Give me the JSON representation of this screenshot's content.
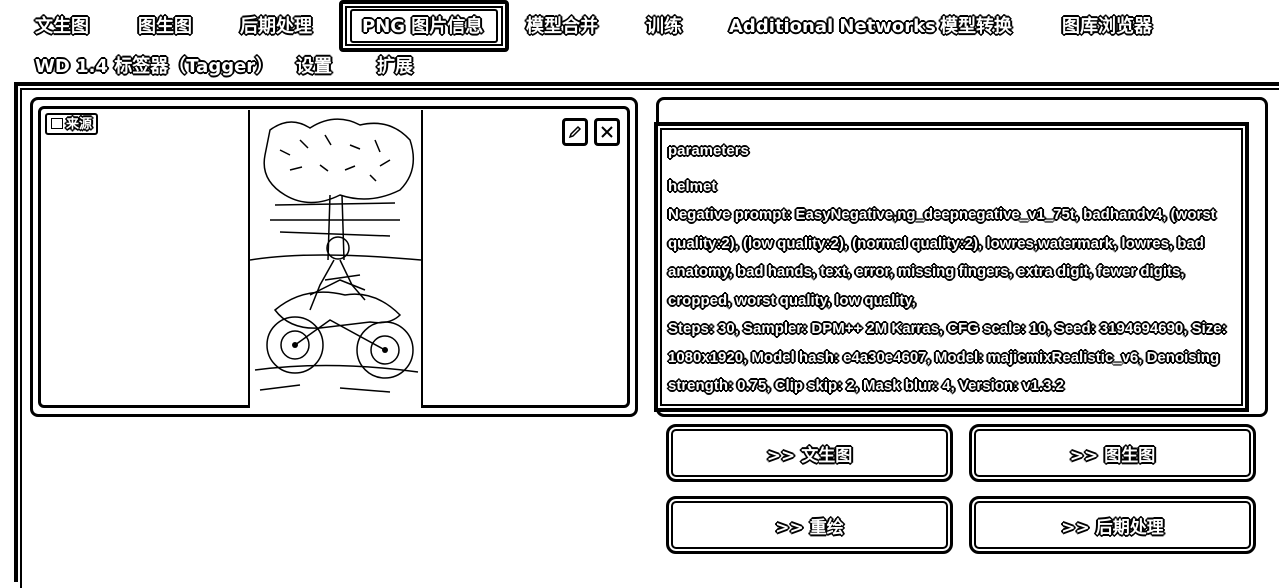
{
  "tabs": {
    "row1": [
      "文生图",
      "图生图",
      "后期处理",
      "PNG 图片信息",
      "模型合并",
      "训练",
      "Additional Networks",
      "模型转换",
      "图库浏览器"
    ],
    "row2": [
      "WD 1.4 标签器（Tagger）",
      "设置",
      "扩展"
    ],
    "active": "PNG 图片信息"
  },
  "source_panel": {
    "label": "来源",
    "label_icon": "image-icon",
    "edit_icon": "pencil-icon",
    "close_icon": "close-icon"
  },
  "parameters": {
    "heading": "parameters",
    "prompt": "helmet",
    "negative": "Negative prompt: EasyNegative,ng_deepnegative_v1_75t, badhandv4, (worst quality:2), (low quality:2), (normal quality:2), lowres,watermark, lowres, bad anatomy, bad hands, text, error, missing fingers, extra digit, fewer digits, cropped, worst quality, low quality,",
    "settings": "Steps: 30, Sampler: DPM++ 2M Karras, CFG scale: 10, Seed: 3194694690, Size: 1080x1920, Model hash: e4a30e4607, Model: majicmixRealistic_v6, Denoising strength: 0.75, Clip skip: 2, Mask blur: 4, Version: v1.3.2"
  },
  "buttons": {
    "txt2img": ">> 文生图",
    "img2img": ">> 图生图",
    "inpaint": ">> 重绘",
    "extras": ">> 后期处理"
  }
}
